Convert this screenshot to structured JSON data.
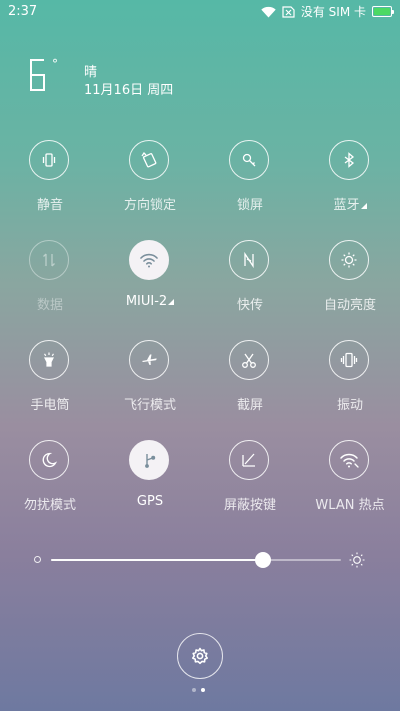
{
  "status_bar": {
    "time": "2:37",
    "no_sim_text": "没有 SIM 卡",
    "battery_level": 1.0,
    "battery_color": "#4cd964"
  },
  "weather": {
    "temperature": "6",
    "degree_symbol": "°",
    "condition": "晴",
    "date": "11月16日 周四"
  },
  "toggles": [
    {
      "label": "静音",
      "icon": "vibrate-silent-icon",
      "state": "off"
    },
    {
      "label": "方向锁定",
      "icon": "rotation-lock-icon",
      "state": "off"
    },
    {
      "label": "锁屏",
      "icon": "key-icon",
      "state": "off"
    },
    {
      "label": "蓝牙",
      "icon": "bluetooth-icon",
      "state": "off",
      "has_more": true
    },
    {
      "label": "数据",
      "icon": "mobile-data-icon",
      "state": "disabled"
    },
    {
      "label": "MIUI-2",
      "icon": "wifi-icon",
      "state": "on",
      "has_more": true
    },
    {
      "label": "快传",
      "icon": "mi-drop-icon",
      "state": "off"
    },
    {
      "label": "自动亮度",
      "icon": "auto-brightness-icon",
      "state": "off"
    },
    {
      "label": "手电筒",
      "icon": "flashlight-icon",
      "state": "off"
    },
    {
      "label": "飞行模式",
      "icon": "airplane-icon",
      "state": "off"
    },
    {
      "label": "截屏",
      "icon": "scissors-icon",
      "state": "off"
    },
    {
      "label": "振动",
      "icon": "vibration-icon",
      "state": "off"
    },
    {
      "label": "勿扰模式",
      "icon": "moon-icon",
      "state": "off"
    },
    {
      "label": "GPS",
      "icon": "gps-icon",
      "state": "on"
    },
    {
      "label": "屏蔽按键",
      "icon": "block-keys-icon",
      "state": "off"
    },
    {
      "label": "WLAN 热点",
      "icon": "hotspot-icon",
      "state": "off"
    }
  ],
  "brightness": {
    "level": 0.73,
    "low_icon": "brightness-low-icon",
    "high_icon": "brightness-high-icon"
  },
  "settings_button": {
    "icon": "gear-icon"
  },
  "page_indicator": {
    "total": 2,
    "current": 2
  },
  "colors": {
    "active_tile": "#f4f2f5",
    "active_icon": "#7a8f9c"
  }
}
